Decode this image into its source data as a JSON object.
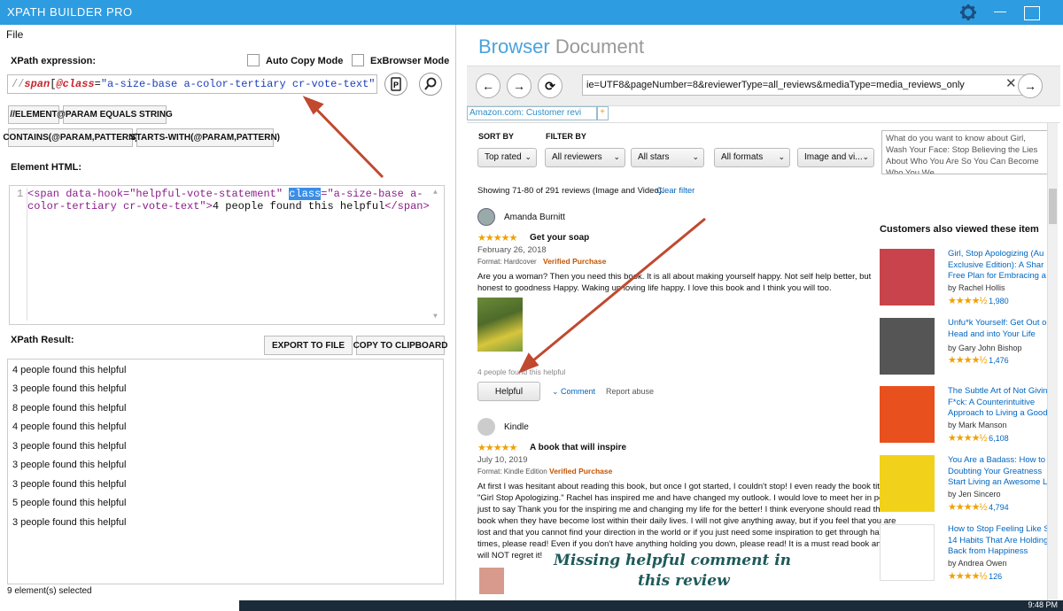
{
  "app": {
    "title": "XPATH BUILDER PRO",
    "menu_file": "File"
  },
  "left": {
    "xpath_label": "XPath expression:",
    "auto_copy_label": "Auto Copy Mode",
    "exbrowser_label": "ExBrowser Mode",
    "xpath_prefix": "//",
    "xpath_tag": "span",
    "xpath_open": "[",
    "xpath_attr": "@class",
    "xpath_eq": "=",
    "xpath_value": "\"a-size-base a-color-tertiary cr-vote-text\"",
    "xpath_close": "]",
    "btn_element": "//ELEMENT",
    "btn_param_equals": "@PARAM EQUALS STRING",
    "btn_contains": "CONTAINS(@PARAM,PATTERN)",
    "btn_starts_with": "STARTS-WITH(@PARAM,PATTERN)",
    "element_html_label": "Element HTML:",
    "html_line_no": "1",
    "html_line1_a": "<span data-hook=\"helpful-vote-statement\" ",
    "html_line1_class": "class",
    "html_line1_b": "=\"a-size-base a-",
    "html_line2_a": "color-tertiary cr-vote-text\">",
    "html_line2_text": "4 people found this helpful",
    "html_line2_close": "</span>",
    "result_label": "XPath Result:",
    "btn_export": "EXPORT TO FILE",
    "btn_copy": "COPY TO CLIPBOARD",
    "results": [
      "4 people found this helpful",
      "3 people found this helpful",
      "8 people found this helpful",
      "4 people found this helpful",
      "3 people found this helpful",
      "3 people found this helpful",
      "3 people found this helpful",
      "5 people found this helpful",
      "3 people found this helpful"
    ],
    "status": "9 element(s) selected"
  },
  "browser": {
    "header_a": "Browser",
    "header_b": "Document",
    "url": "ie=UTF8&pageNumber=8&reviewerType=all_reviews&mediaType=media_reviews_only",
    "tab_label": "Amazon.com: Customer revi",
    "tab_plus": "+",
    "sort_by": "SORT BY",
    "filter_by": "FILTER BY",
    "sort_value": "Top rated",
    "filter_reviewers": "All reviewers",
    "filter_stars": "All stars",
    "filter_formats": "All formats",
    "filter_media": "Image and vi...",
    "search_text": "What do you want to know about Girl, Wash Your Face: Stop Believing the Lies About Who You Are So You Can Become Who You We",
    "showing": "Showing 71-80 of 291 reviews (Image and Video).",
    "clear_filter": "Clear filter",
    "review1": {
      "name": "Amanda Burnitt",
      "stars": "★★★★★",
      "title": "Get your soap",
      "date": "February 26, 2018",
      "format": "Format: Hardcover",
      "verified": "Verified Purchase",
      "line1": "Are you a woman? Then you need this book. It is all about making yourself happy. Not self help better, but",
      "line2": "honest to goodness Happy. Waking up loving life happy. I love this book and I think you will too.",
      "helpful_stmt": "4 people found this helpful",
      "helpful_btn": "Helpful",
      "comment": "Comment",
      "report": "Report abuse"
    },
    "review2": {
      "name": "Kindle",
      "stars": "★★★★★",
      "title": "A book that will inspire",
      "date": "July 10, 2019",
      "format": "Format: Kindle Edition",
      "verified": "Verified Purchase",
      "lines": [
        "At first I was hesitant about reading this book, but once I got started, I couldn't stop! I even ready the book titled",
        "\"Girl Stop Apologizing.\" Rachel has inspired me and have changed my outlook. I would love to meet her in person",
        "just to say Thank you for the inspiring me and changing my life for the better! I think everyone should read this",
        "book when they have become lost within their daily lives. I will not give anything away, but if you feel that you are",
        "lost and that you cannot find your direction in the world or if you just need some inspiration to get through hard",
        "times, please read! Even if you don't have anything holding you down, please read! It is a must read book and you",
        "will NOT regret it!"
      ]
    },
    "annotation_1": "Missing helpful comment in",
    "annotation_2": "this review",
    "also_viewed": "Customers also viewed these item",
    "products": [
      {
        "t1": "Girl, Stop Apologizing (Au",
        "t2": "Exclusive Edition): A Shar",
        "t3": "Free Plan for Embracing a",
        "author": "by Rachel Hollis",
        "count": "1,980",
        "cover": "#c8434b"
      },
      {
        "t1": "Unfu*k Yourself: Get Out o",
        "t2": "Head and into Your Life",
        "t3": "",
        "author": "by Gary John Bishop",
        "count": "1,476",
        "cover": "#555555"
      },
      {
        "t1": "The Subtle Art of Not Givin",
        "t2": "F*ck: A Counterintuitive",
        "t3": "Approach to Living a Good",
        "author": "by Mark Manson",
        "count": "6,108",
        "cover": "#e8501e"
      },
      {
        "t1": "You Are a Badass: How to",
        "t2": "Doubting Your Greatness",
        "t3": "Start Living an Awesome L",
        "author": "by Jen Sincero",
        "count": "4,794",
        "cover": "#f2d11a"
      },
      {
        "t1": "How to Stop Feeling Like S",
        "t2": "14 Habits That Are Holding",
        "t3": "Back from Happiness",
        "author": "by Andrea Owen",
        "count": "126",
        "cover": "#ffffff"
      }
    ],
    "stars_row": "★★★★½"
  },
  "taskbar": {
    "time": "9:48 PM"
  },
  "colors": {
    "accent": "#2e9ce0",
    "arrow": "#c0492f"
  }
}
